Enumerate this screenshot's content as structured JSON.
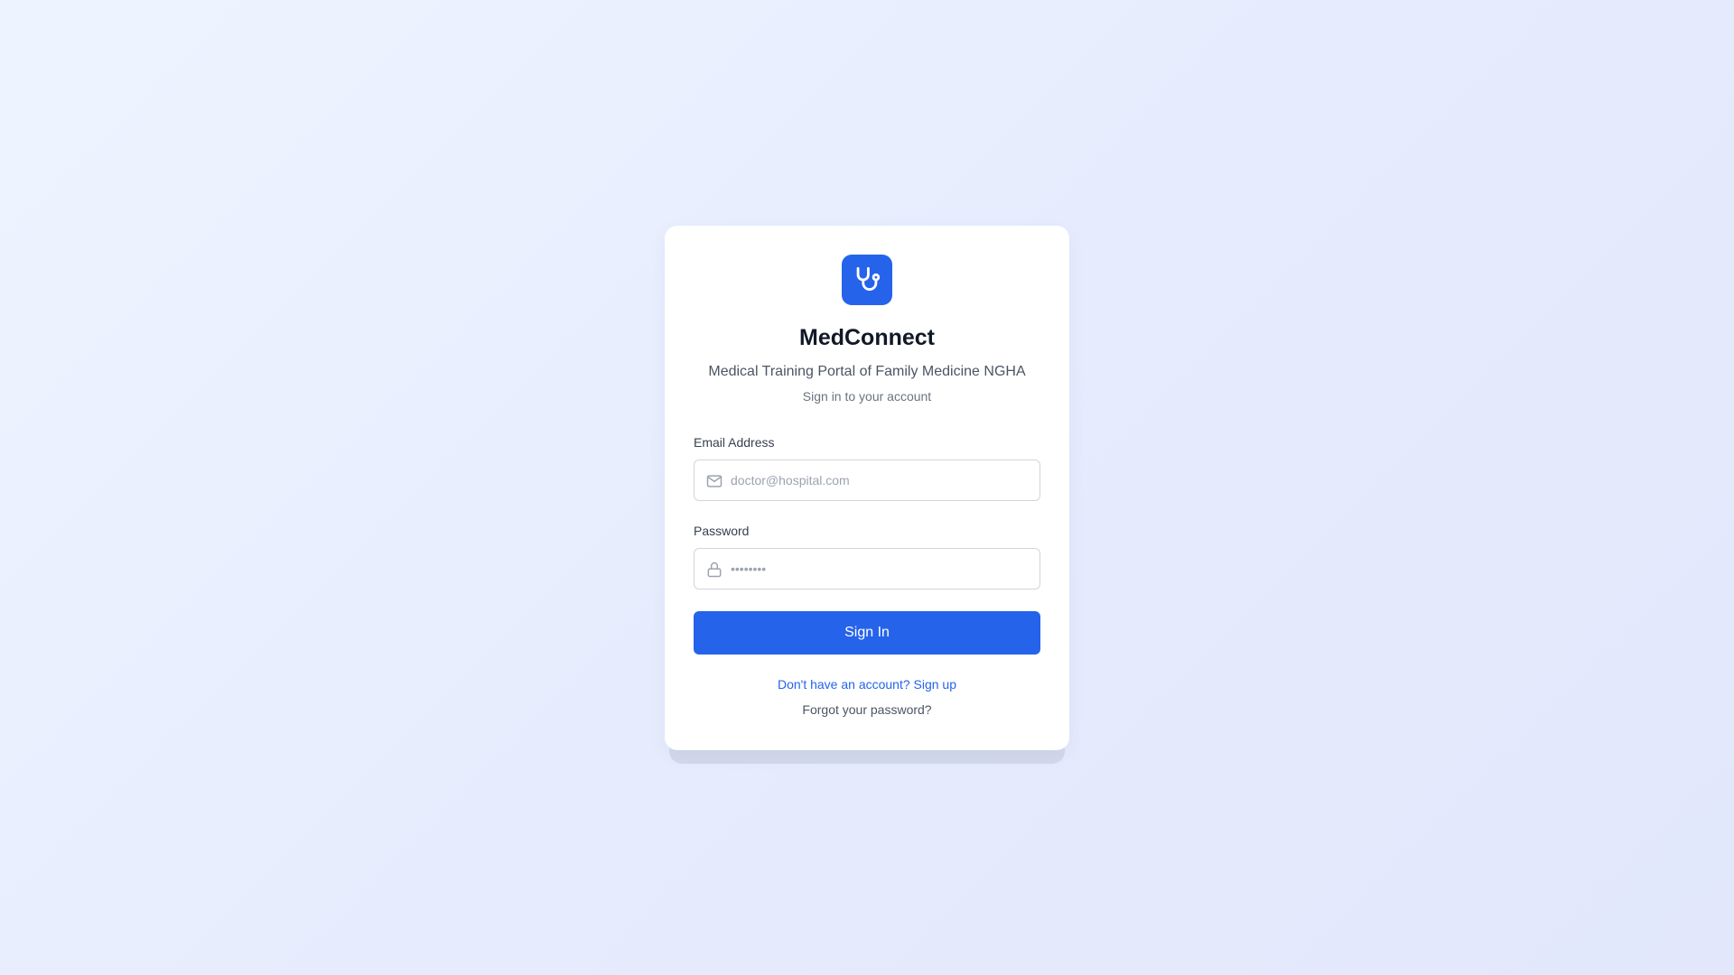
{
  "app": {
    "logo_icon": "stethoscope-icon",
    "brand_color": "#2563eb",
    "title": "MedConnect",
    "subtitle": "Medical Training Portal of Family Medicine NGHA",
    "tagline": "Sign in to your account"
  },
  "form": {
    "email": {
      "label": "Email Address",
      "placeholder": "doctor@hospital.com",
      "value": "",
      "icon": "mail-icon"
    },
    "password": {
      "label": "Password",
      "placeholder": "••••••••",
      "value": "",
      "icon": "lock-icon"
    },
    "submit_label": "Sign In"
  },
  "links": {
    "signup": "Don't have an account? Sign up",
    "forgot": "Forgot your password?"
  }
}
